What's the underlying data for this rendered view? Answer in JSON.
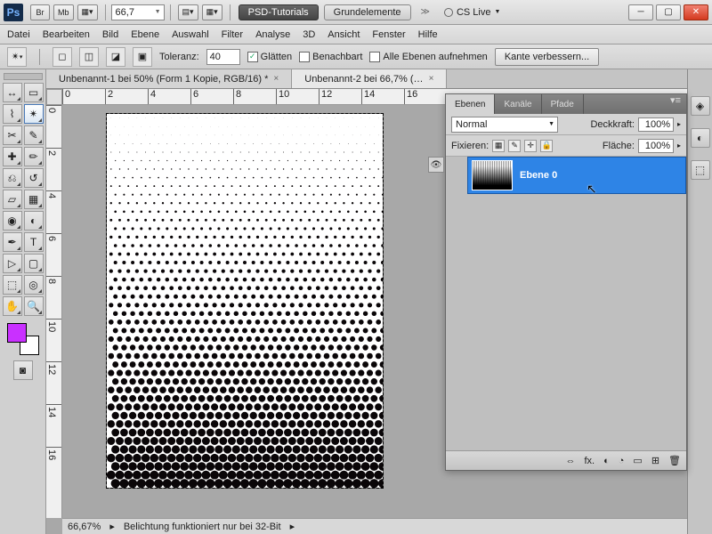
{
  "titlebar": {
    "zoom": "66,7",
    "pill1": "PSD-Tutorials",
    "pill2": "Grundelemente",
    "cslive": "CS Live"
  },
  "menu": [
    "Datei",
    "Bearbeiten",
    "Bild",
    "Ebene",
    "Auswahl",
    "Filter",
    "Analyse",
    "3D",
    "Ansicht",
    "Fenster",
    "Hilfe"
  ],
  "options": {
    "tolerance_label": "Toleranz:",
    "tolerance": "40",
    "glaetten": "Glätten",
    "benachbart": "Benachbart",
    "alle": "Alle Ebenen aufnehmen",
    "refine": "Kante verbessern..."
  },
  "tabs": [
    {
      "label": "Unbenannt-1 bei 50% (Form 1 Kopie, RGB/16) *",
      "active": false
    },
    {
      "label": "Unbenannt-2 bei 66,7% (…",
      "active": true
    }
  ],
  "ruler_h": [
    "0",
    "2",
    "4",
    "6",
    "8",
    "10",
    "12",
    "14",
    "16"
  ],
  "ruler_v": [
    "0",
    "2",
    "4",
    "6",
    "8",
    "10",
    "12",
    "14",
    "16"
  ],
  "status": {
    "zoom": "66,67%",
    "msg": "Belichtung funktioniert nur bei 32-Bit"
  },
  "layers_panel": {
    "tabs": [
      "Ebenen",
      "Kanäle",
      "Pfade"
    ],
    "blend": "Normal",
    "opacity_label": "Deckkraft:",
    "opacity": "100%",
    "fix_label": "Fixieren:",
    "fill_label": "Fläche:",
    "fill": "100%",
    "layer_name": "Ebene 0",
    "foot_icons": [
      "⇔",
      "fx.",
      "◐",
      "◔",
      "▭",
      "⊞",
      "🗑"
    ]
  },
  "colors": {
    "foreground": "#c930ff",
    "background": "#ffffff"
  }
}
